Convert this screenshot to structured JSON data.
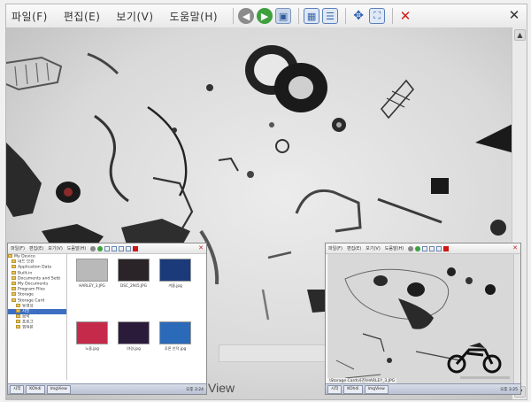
{
  "main_window": {
    "menus": [
      "파일(F)",
      "편집(E)",
      "보기(V)",
      "도움말(H)"
    ],
    "toolbar_icons": [
      "back-icon",
      "forward-icon",
      "image-icon",
      "thumbnail-view-icon",
      "list-view-icon",
      "move-icon",
      "fullscreen-icon",
      "delete-icon"
    ],
    "close_label": "✕",
    "watermark_text": "View"
  },
  "left_window": {
    "menus": [
      "파일(F)",
      "편집(E)",
      "보기(V)",
      "도움말(H)"
    ],
    "close_label": "✕",
    "tree": [
      "My Device",
      "내드 보관",
      "Application Data",
      "Built-in",
      "Documents and Setti",
      "My Documents",
      "Program Files",
      "Storage",
      "Storage Card",
      "동영상",
      "사진",
      "음악",
      "프로그",
      "캡쳐본"
    ],
    "selected_tree_index": 10,
    "thumbnails": [
      {
        "caption": "HARLEY_3.JPG",
        "color": "#b9b9b9"
      },
      {
        "caption": "DSC_2945.JPG",
        "color": "#2a2328"
      },
      {
        "caption": "겨울.jpg",
        "color": "#1a3a7a"
      },
      {
        "caption": "노을.jpg",
        "color": "#c62a4a"
      },
      {
        "caption": "야경.jpg",
        "color": "#2b1b3b"
      },
      {
        "caption": "푸른 언덕.jpg",
        "color": "#2a6ab8"
      }
    ],
    "taskbar": {
      "start": "시작",
      "task1": "KOhdi",
      "task2": "ImgView",
      "clock": "오후 3:24"
    }
  },
  "right_window": {
    "menus": [
      "파일(F)",
      "편집(E)",
      "보기(V)",
      "도움말(H)"
    ],
    "close_label": "✕",
    "status_path": "\\Storage Card\\사진\\HARLEY_3.JPG",
    "taskbar": {
      "start": "시작",
      "task1": "KOhdi",
      "task2": "ImgView",
      "clock": "오후 3:25"
    }
  }
}
